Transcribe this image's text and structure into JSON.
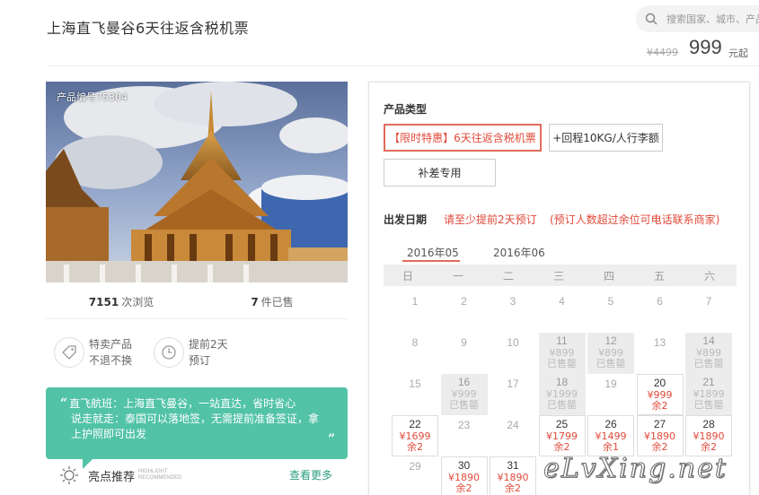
{
  "product": {
    "title": "上海直飞曼谷6天往返含税机票",
    "old_price": "¥4499",
    "price": "999",
    "price_suffix": "元起",
    "code": "产品编号75304"
  },
  "search": {
    "placeholder": "搜索国家、城市、产品"
  },
  "stats": {
    "views_count": "7151",
    "views_label": "次浏览",
    "sold_count": "7",
    "sold_label": "件已售"
  },
  "features": [
    {
      "icon": "tag-icon",
      "line1": "特卖产品",
      "line2": "不退不换"
    },
    {
      "icon": "clock-icon",
      "line1": "提前2天",
      "line2": "预订"
    }
  ],
  "bubble": {
    "line1": "直飞航班：上海直飞曼谷，一站直达，省时省心",
    "line2": "说走就走：泰国可以落地签，无需提前准备签证，拿",
    "line3": "上护照即可出发"
  },
  "highlight": {
    "label": "亮点推荐",
    "en1": "HIGHLIGHT",
    "en2": "RECOMMENDED",
    "more": "查看更多"
  },
  "booking": {
    "type_label": "产品类型",
    "options": [
      "【限时特惠】6天往返含税机票",
      "+回程10KG/人行李额",
      "补差专用"
    ],
    "date_label": "出发日期",
    "note1": "请至少提前2天预订",
    "note2": "(预订人数超过余位可电话联系商家)",
    "months": [
      "2016年05",
      "2016年06"
    ],
    "weekdays": [
      "日",
      "一",
      "二",
      "三",
      "四",
      "五",
      "六"
    ]
  },
  "calendar": {
    "sold_text": "已售罄",
    "days": [
      {
        "d": "1",
        "state": "plain"
      },
      {
        "d": "2",
        "state": "plain"
      },
      {
        "d": "3",
        "state": "plain"
      },
      {
        "d": "4",
        "state": "plain"
      },
      {
        "d": "5",
        "state": "plain"
      },
      {
        "d": "6",
        "state": "plain"
      },
      {
        "d": "7",
        "state": "plain"
      },
      {
        "d": "8",
        "state": "plain"
      },
      {
        "d": "9",
        "state": "plain"
      },
      {
        "d": "10",
        "state": "plain"
      },
      {
        "d": "11",
        "state": "sold",
        "price": "¥899"
      },
      {
        "d": "12",
        "state": "sold",
        "price": "¥899"
      },
      {
        "d": "13",
        "state": "plain"
      },
      {
        "d": "14",
        "state": "sold",
        "price": "¥899"
      },
      {
        "d": "15",
        "state": "plain"
      },
      {
        "d": "16",
        "state": "sold",
        "price": "¥999"
      },
      {
        "d": "17",
        "state": "plain"
      },
      {
        "d": "18",
        "state": "sold",
        "price": "¥1999"
      },
      {
        "d": "19",
        "state": "plain"
      },
      {
        "d": "20",
        "state": "avail",
        "price": "¥999",
        "left": "余2"
      },
      {
        "d": "21",
        "state": "sold",
        "price": "¥1899"
      },
      {
        "d": "22",
        "state": "avail",
        "price": "¥1699",
        "left": "余2"
      },
      {
        "d": "23",
        "state": "plain"
      },
      {
        "d": "24",
        "state": "plain"
      },
      {
        "d": "25",
        "state": "avail",
        "price": "¥1799",
        "left": "余2"
      },
      {
        "d": "26",
        "state": "avail",
        "price": "¥1499",
        "left": "余1"
      },
      {
        "d": "27",
        "state": "avail",
        "price": "¥1890",
        "left": "余2"
      },
      {
        "d": "28",
        "state": "avail",
        "price": "¥1890",
        "left": "余2"
      },
      {
        "d": "29",
        "state": "plain"
      },
      {
        "d": "30",
        "state": "avail",
        "price": "¥1890",
        "left": "余2"
      },
      {
        "d": "31",
        "state": "avail",
        "price": "¥1890",
        "left": "余2"
      }
    ]
  },
  "watermark": "eLvXing.net"
}
